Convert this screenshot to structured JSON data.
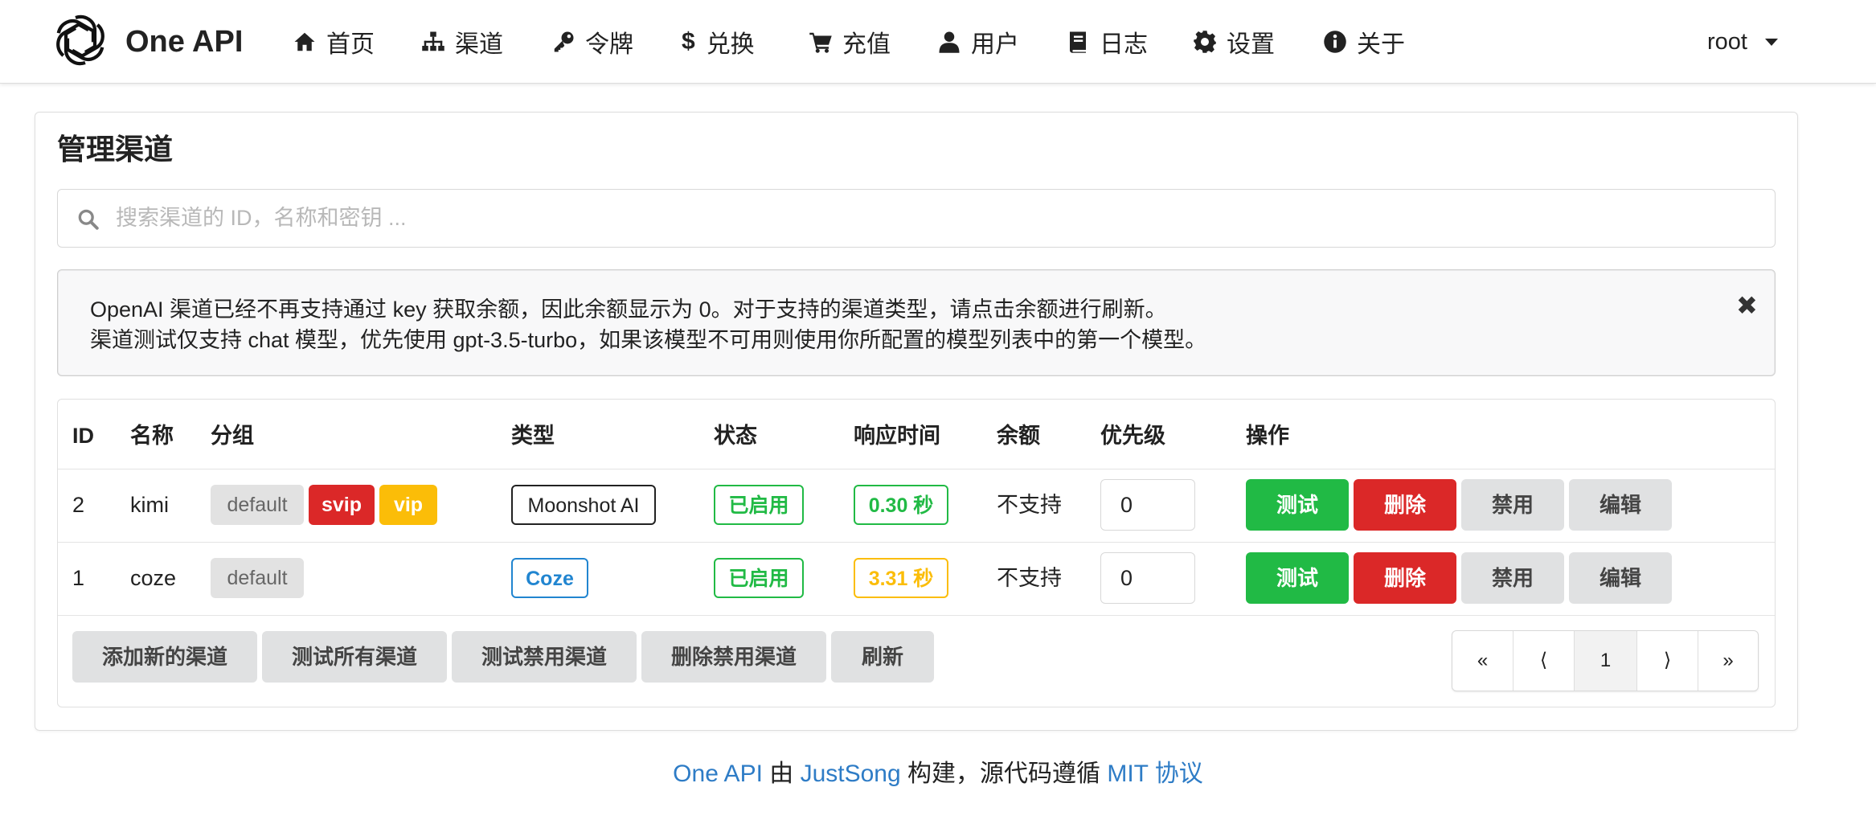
{
  "app": {
    "brand": "One API"
  },
  "nav": {
    "items": [
      {
        "label": "首页",
        "icon": "home-icon"
      },
      {
        "label": "渠道",
        "icon": "sitemap-icon"
      },
      {
        "label": "令牌",
        "icon": "key-icon"
      },
      {
        "label": "兑换",
        "icon": "dollar-icon"
      },
      {
        "label": "充值",
        "icon": "cart-icon"
      },
      {
        "label": "用户",
        "icon": "user-icon"
      },
      {
        "label": "日志",
        "icon": "book-icon"
      },
      {
        "label": "设置",
        "icon": "gear-icon"
      },
      {
        "label": "关于",
        "icon": "info-icon"
      }
    ],
    "user": "root"
  },
  "page": {
    "title": "管理渠道",
    "search_placeholder": "搜索渠道的 ID，名称和密钥 ...",
    "notice": [
      "OpenAI 渠道已经不再支持通过 key 获取余额，因此余额显示为 0。对于支持的渠道类型，请点击余额进行刷新。",
      "渠道测试仅支持 chat 模型，优先使用 gpt-3.5-turbo，如果该模型不可用则使用你所配置的模型列表中的第一个模型。"
    ],
    "notice_close": "✖"
  },
  "table": {
    "headers": [
      "ID",
      "名称",
      "分组",
      "类型",
      "状态",
      "响应时间",
      "余额",
      "优先级",
      "操作"
    ],
    "rows": [
      {
        "id": "2",
        "name": "kimi",
        "groups": [
          "default",
          "svip",
          "vip"
        ],
        "type": "Moonshot AI",
        "status": "已启用",
        "response": "0.30 秒",
        "balance": "不支持",
        "priority": "0",
        "actions": [
          "测试",
          "删除",
          "禁用",
          "编辑"
        ]
      },
      {
        "id": "1",
        "name": "coze",
        "groups": [
          "default"
        ],
        "type": "Coze",
        "status": "已启用",
        "response": "3.31 秒",
        "balance": "不支持",
        "priority": "0",
        "actions": [
          "测试",
          "删除",
          "禁用",
          "编辑"
        ]
      }
    ]
  },
  "bottom_buttons": [
    "添加新的渠道",
    "测试所有渠道",
    "测试禁用渠道",
    "删除禁用渠道",
    "刷新"
  ],
  "pagination": {
    "first": "«",
    "prev": "⟨",
    "current": "1",
    "next": "⟩",
    "last": "»"
  },
  "footer": {
    "brand_link": "One API",
    "by": " 由 ",
    "author_link": "JustSong",
    "middle": " 构建，源代码遵循 ",
    "license_link": "MIT 协议"
  },
  "colors": {
    "green": "#21ba45",
    "red": "#db2828",
    "yellow": "#fbbd08",
    "blue": "#2185d0",
    "link": "#2e7cc6"
  }
}
